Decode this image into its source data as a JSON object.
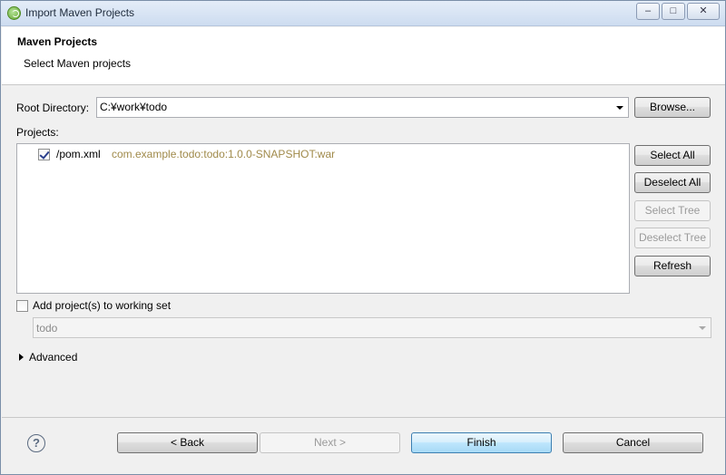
{
  "window": {
    "title": "Import Maven Projects",
    "minimize": "–",
    "maximize": "□",
    "close": "✕"
  },
  "header": {
    "title": "Maven Projects",
    "subtitle": "Select Maven projects"
  },
  "root_directory": {
    "label": "Root Directory:",
    "value": "C:¥work¥todo",
    "browse_label": "Browse..."
  },
  "projects": {
    "label": "Projects:",
    "items": [
      {
        "name": "/pom.xml",
        "id": "com.example.todo:todo:1.0.0-SNAPSHOT:war",
        "checked": true
      }
    ],
    "buttons": {
      "select_all": "Select All",
      "deselect_all": "Deselect All",
      "select_tree": "Select Tree",
      "deselect_tree": "Deselect Tree",
      "refresh": "Refresh"
    }
  },
  "working_set": {
    "label": "Add project(s) to working set",
    "value": "todo"
  },
  "advanced": {
    "label": "Advanced"
  },
  "footer": {
    "help": "?",
    "back": "< Back",
    "next": "Next >",
    "finish": "Finish",
    "cancel": "Cancel"
  },
  "icons": {
    "app": "eclipse-spring-icon",
    "help": "help-icon",
    "expand": "triangle-right-icon"
  }
}
